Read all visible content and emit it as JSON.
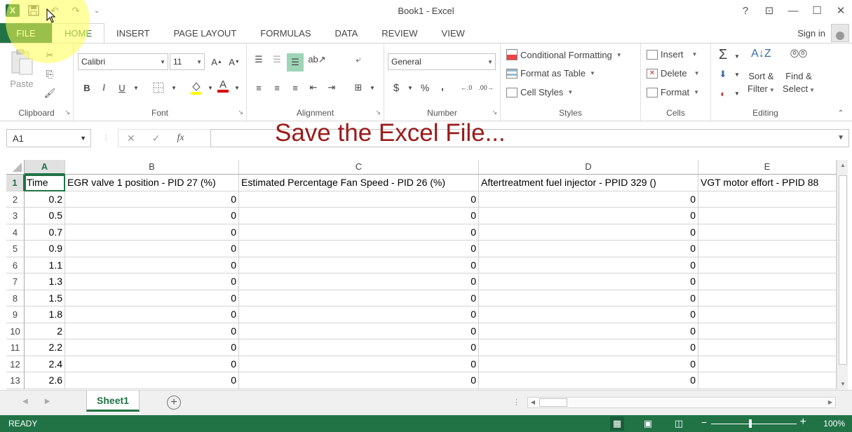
{
  "window": {
    "title": "Book1 - Excel",
    "logo_text": "X",
    "help": "?",
    "restore_ribbon": "⊡",
    "minimize": "—",
    "maximize": "☐",
    "close": "✕"
  },
  "qat": {
    "save": "💾",
    "undo": "↶",
    "redo": "↷",
    "customize": "⌄"
  },
  "tabs": [
    "FILE",
    "HOME",
    "INSERT",
    "PAGE LAYOUT",
    "FORMULAS",
    "DATA",
    "REVIEW",
    "VIEW"
  ],
  "signin": "Sign in",
  "ribbon": {
    "clipboard": {
      "label": "Clipboard",
      "paste": "Paste"
    },
    "font": {
      "label": "Font",
      "name": "Calibri",
      "size": "11",
      "bold": "B",
      "italic": "I",
      "underline": "U"
    },
    "alignment": {
      "label": "Alignment"
    },
    "number": {
      "label": "Number",
      "format": "General",
      "currency": "$",
      "percent": "%",
      "comma": ","
    },
    "styles": {
      "label": "Styles",
      "conditional": "Conditional Formatting",
      "format_table": "Format as Table",
      "cell_styles": "Cell Styles"
    },
    "cells": {
      "label": "Cells",
      "insert": "Insert",
      "delete": "Delete",
      "format": "Format"
    },
    "editing": {
      "label": "Editing",
      "sort_1": "Sort &",
      "sort_2": "Filter",
      "find_1": "Find &",
      "find_2": "Select"
    }
  },
  "formula_bar": {
    "name_box": "A1",
    "fx": "fx",
    "cancel": "✕",
    "enter": "✓"
  },
  "caption": "Save the Excel File...",
  "grid": {
    "columns": [
      "A",
      "B",
      "C",
      "D",
      "E"
    ],
    "headers": [
      "Time",
      "EGR valve 1 position - PID 27 (%)",
      "Estimated Percentage Fan Speed - PID 26 (%)",
      "Aftertreatment fuel injector - PPID 329 ()",
      "VGT motor effort - PPID 88"
    ],
    "row_numbers": [
      "1",
      "2",
      "3",
      "4",
      "5",
      "6",
      "7",
      "8",
      "9",
      "10",
      "11",
      "12",
      "13"
    ],
    "rows": [
      [
        "0.2",
        "0",
        "0",
        "0",
        ""
      ],
      [
        "0.5",
        "0",
        "0",
        "0",
        ""
      ],
      [
        "0.7",
        "0",
        "0",
        "0",
        ""
      ],
      [
        "0.9",
        "0",
        "0",
        "0",
        ""
      ],
      [
        "1.1",
        "0",
        "0",
        "0",
        ""
      ],
      [
        "1.3",
        "0",
        "0",
        "0",
        ""
      ],
      [
        "1.5",
        "0",
        "0",
        "0",
        ""
      ],
      [
        "1.8",
        "0",
        "0",
        "0",
        ""
      ],
      [
        "2",
        "0",
        "0",
        "0",
        ""
      ],
      [
        "2.2",
        "0",
        "0",
        "0",
        ""
      ],
      [
        "2.4",
        "0",
        "0",
        "0",
        ""
      ],
      [
        "2.6",
        "0",
        "0",
        "0",
        ""
      ]
    ]
  },
  "sheets": {
    "active": "Sheet1",
    "add": "+"
  },
  "status": {
    "text": "READY",
    "zoom": "100%"
  },
  "colors": {
    "accent": "#217346",
    "caption": "#9b1b1b"
  }
}
